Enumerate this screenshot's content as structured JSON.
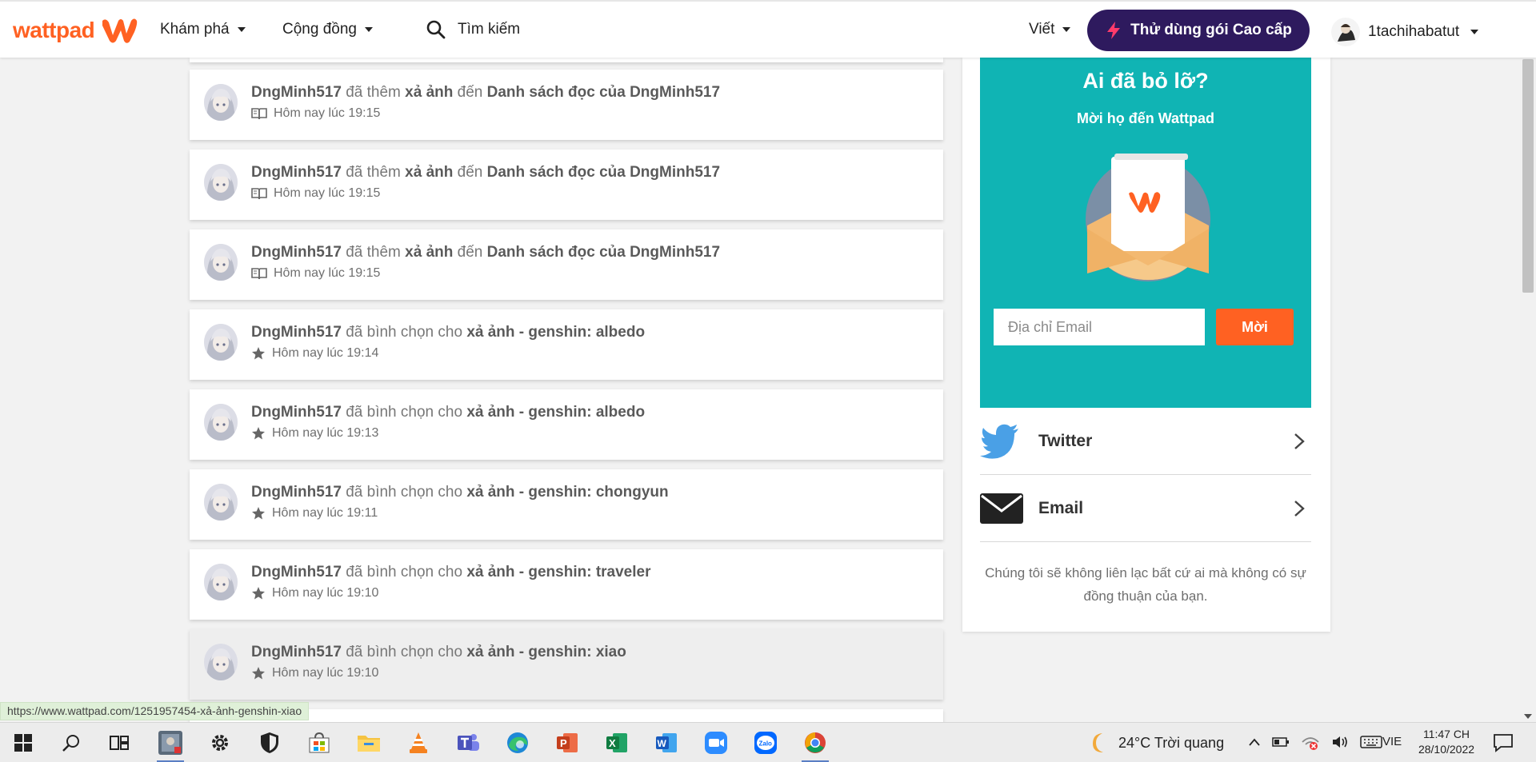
{
  "nav": {
    "logo": "wattpad",
    "explore": "Khám phá",
    "community": "Cộng đồng",
    "search_label": "Tìm kiếm",
    "write": "Viết",
    "premium": "Thử dùng gói Cao cấp",
    "username": "1tachihabatut"
  },
  "feed": [
    {
      "user": "DngMinh517",
      "action": "đã thêm",
      "story": "xả ảnh",
      "mid": "đến",
      "target": "Danh sách đọc của DngMinh517",
      "time": "Hôm nay lúc 19:15",
      "icon": "book-icon"
    },
    {
      "user": "DngMinh517",
      "action": "đã thêm",
      "story": "xả ảnh",
      "mid": "đến",
      "target": "Danh sách đọc của DngMinh517",
      "time": "Hôm nay lúc 19:15",
      "icon": "book-icon"
    },
    {
      "user": "DngMinh517",
      "action": "đã thêm",
      "story": "xả ảnh",
      "mid": "đến",
      "target": "Danh sách đọc của DngMinh517",
      "time": "Hôm nay lúc 19:15",
      "icon": "book-icon"
    },
    {
      "user": "DngMinh517",
      "action": "đã bình chọn cho",
      "story": "xả ảnh - genshin: albedo",
      "mid": "",
      "target": "",
      "time": "Hôm nay lúc 19:14",
      "icon": "star-icon"
    },
    {
      "user": "DngMinh517",
      "action": "đã bình chọn cho",
      "story": "xả ảnh - genshin: albedo",
      "mid": "",
      "target": "",
      "time": "Hôm nay lúc 19:13",
      "icon": "star-icon"
    },
    {
      "user": "DngMinh517",
      "action": "đã bình chọn cho",
      "story": "xả ảnh - genshin: chongyun",
      "mid": "",
      "target": "",
      "time": "Hôm nay lúc 19:11",
      "icon": "star-icon"
    },
    {
      "user": "DngMinh517",
      "action": "đã bình chọn cho",
      "story": "xả ảnh - genshin: traveler",
      "mid": "",
      "target": "",
      "time": "Hôm nay lúc 19:10",
      "icon": "star-icon"
    },
    {
      "user": "DngMinh517",
      "action": "đã bình chọn cho",
      "story": "xả ảnh - genshin: xiao",
      "mid": "",
      "target": "",
      "time": "Hôm nay lúc 19:10",
      "icon": "star-icon"
    }
  ],
  "invite": {
    "title": "Ai đã bỏ lỡ?",
    "subtitle": "Mời họ đến Wattpad",
    "email_placeholder": "Địa chỉ Email",
    "button": "Mời"
  },
  "share": {
    "twitter": "Twitter",
    "email": "Email"
  },
  "disclaimer": "Chúng tôi sẽ không liên lạc bất cứ ai mà không có sự đồng thuận của bạn.",
  "status_url": "https://www.wattpad.com/1251957454-xả-ảnh-genshin-xiao",
  "taskbar": {
    "weather": "24°C  Trời quang",
    "lang": "VIE",
    "time": "11:47 CH",
    "date": "28/10/2022"
  },
  "colors": {
    "brand_orange": "#ff6122",
    "premium_purple": "#2e1a5e",
    "invite_teal": "#10b4b4",
    "twitter_blue": "#4aa0e6"
  }
}
